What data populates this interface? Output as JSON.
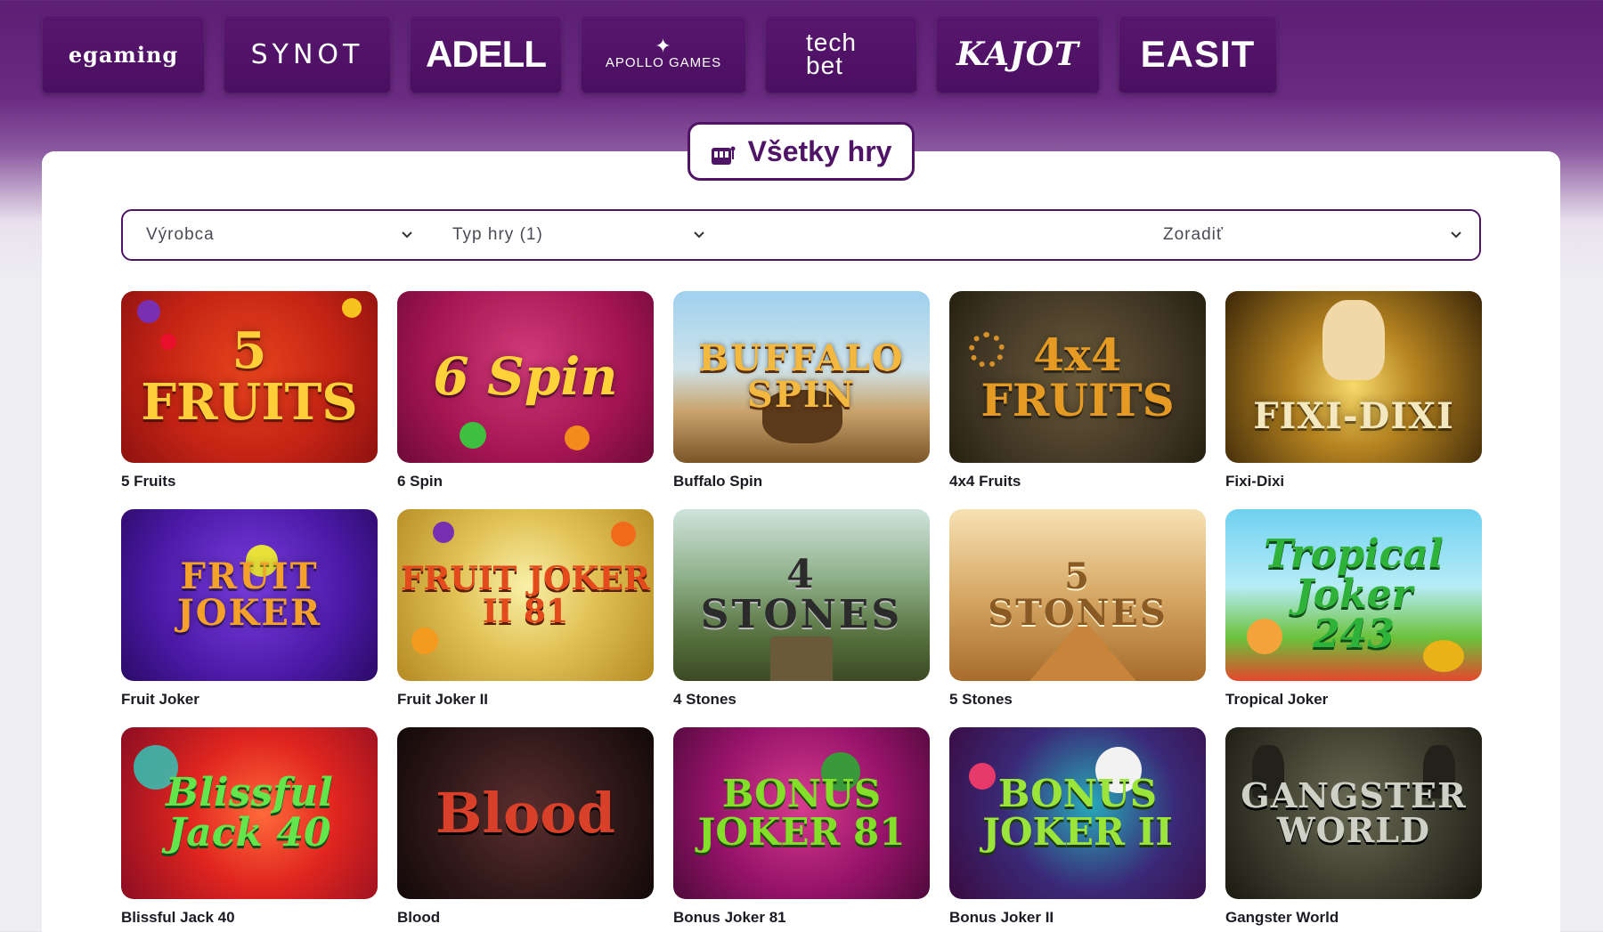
{
  "providers": [
    {
      "label": "egaming"
    },
    {
      "label": "SYNOT"
    },
    {
      "label": "ADELL"
    },
    {
      "label": "APOLLO GAMES"
    },
    {
      "label_top": "tech",
      "label_bottom": "bet"
    },
    {
      "label": "KAJOT"
    },
    {
      "label": "EASIT"
    }
  ],
  "all_games_button": {
    "label": "Všetky hry",
    "icon": "slot-machine-icon"
  },
  "filters": {
    "maker": "Výrobca",
    "type": "Typ hry (1)",
    "sort": "Zoradiť"
  },
  "games": [
    {
      "name": "5 Fruits",
      "art": "5\nFRUITS"
    },
    {
      "name": "6 Spin",
      "art": "6 Spin"
    },
    {
      "name": "Buffalo Spin",
      "art": "BUFFALO\nSPIN"
    },
    {
      "name": "4x4 Fruits",
      "art": "4x4\nFRUITS"
    },
    {
      "name": "Fixi-Dixi",
      "art": "FIXI-DIXI"
    },
    {
      "name": "Fruit Joker",
      "art": "FRUIT\nJOKER"
    },
    {
      "name": "Fruit Joker II",
      "art": "FRUIT JOKER\nII 81"
    },
    {
      "name": "4 Stones",
      "art": "4\nSTONES"
    },
    {
      "name": "5 Stones",
      "art": "5\nSTONES"
    },
    {
      "name": "Tropical Joker",
      "art": "Tropical\nJoker\n243"
    },
    {
      "name": "Blissful Jack 40",
      "art": "Blissful\nJack 40"
    },
    {
      "name": "Blood",
      "art": "Blood"
    },
    {
      "name": "Bonus Joker 81",
      "art": "BONUS\nJOKER 81"
    },
    {
      "name": "Bonus Joker II",
      "art": "BONUS\nJOKER II"
    },
    {
      "name": "Gangster World",
      "art": "GANGSTER\nWORLD"
    }
  ],
  "colors": {
    "brand_purple": "#4f1466",
    "header_purple": "#5c1f74",
    "text_dark": "#1b1b24"
  }
}
